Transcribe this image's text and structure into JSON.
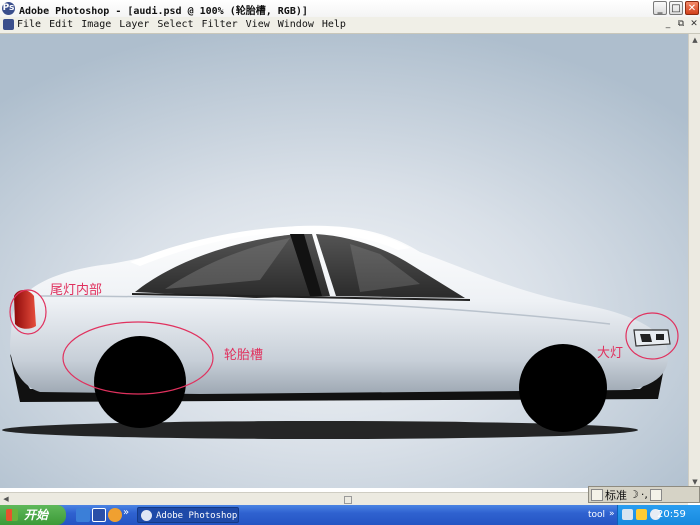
{
  "window": {
    "title": "Adobe Photoshop - [audi.psd @ 100% (轮胎槽, RGB)]",
    "app_icon": "Ps",
    "minimize": "_",
    "maximize": "□",
    "close": "✕"
  },
  "menu": {
    "items": [
      "File",
      "Edit",
      "Image",
      "Layer",
      "Select",
      "Filter",
      "View",
      "Window",
      "Help"
    ],
    "doc_minimize": "_",
    "doc_restore": "⧉",
    "doc_close": "✕"
  },
  "annotations": {
    "tail_light": "尾灯内部",
    "wheel_well": "轮胎槽",
    "headlight": "大灯"
  },
  "ime": {
    "mode": "标准",
    "moon_icon": "☽",
    "punct": "·,"
  },
  "taskbar": {
    "start_label": "开始",
    "more": "»",
    "task_button": "Adobe Photoshop ...",
    "tool_label": "tool",
    "tool_arrow": "»",
    "clock": "20:59"
  },
  "colors": {
    "annotation": "#e0315e",
    "taskbar": "#2f62d0",
    "start": "#3c9a37",
    "canvas_bg": "#d9e0e8"
  }
}
